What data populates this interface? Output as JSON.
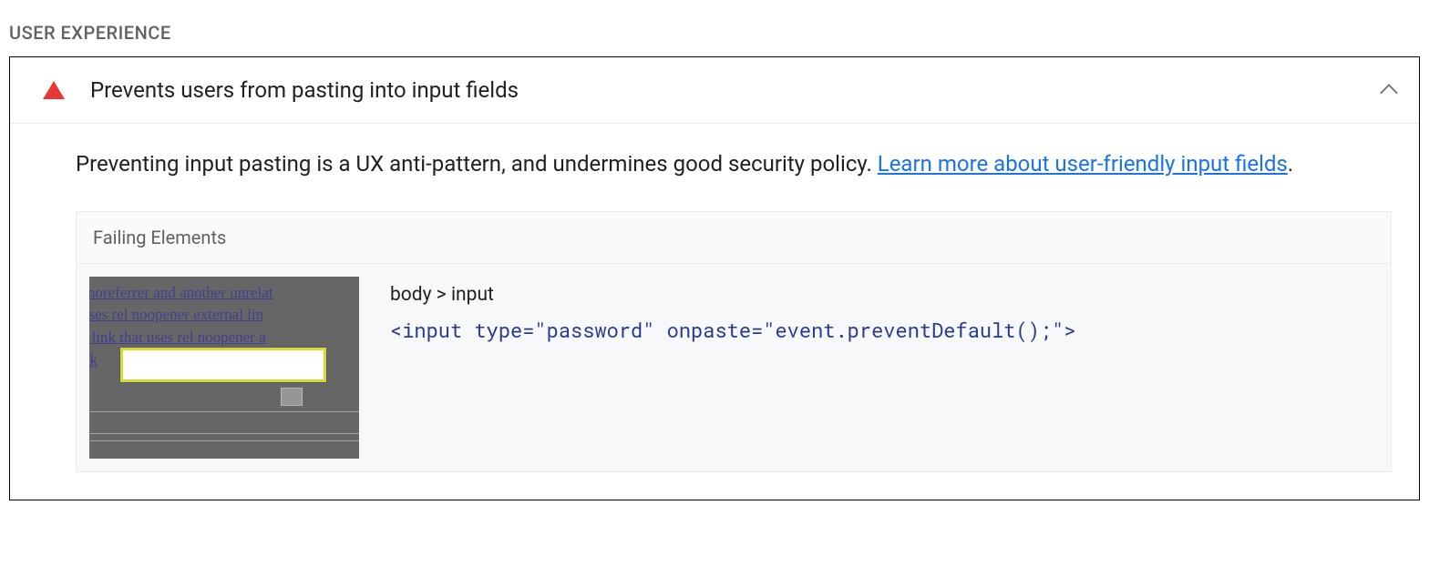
{
  "section": {
    "label": "USER EXPERIENCE"
  },
  "audit": {
    "title": "Prevents users from pasting into input fields",
    "description": "Preventing input pasting is a UX anti-pattern, and undermines good security policy. ",
    "link_text": "Learn more about user-friendly input fields",
    "description_suffix": "."
  },
  "failing": {
    "header": "Failing Elements",
    "thumbnail_text": {
      "line1": " noreferrer and another unrelat",
      "line2": "t uses rel noopener external lin",
      "line3": "al link that uses rel noopener a",
      "line4": " ok"
    },
    "selector": "body > input",
    "code": "<input type=\"password\" onpaste=\"event.preventDefault();\">"
  },
  "colors": {
    "fail_triangle": "#e53935",
    "link": "#1a73e8",
    "code": "#2b3a8f"
  }
}
